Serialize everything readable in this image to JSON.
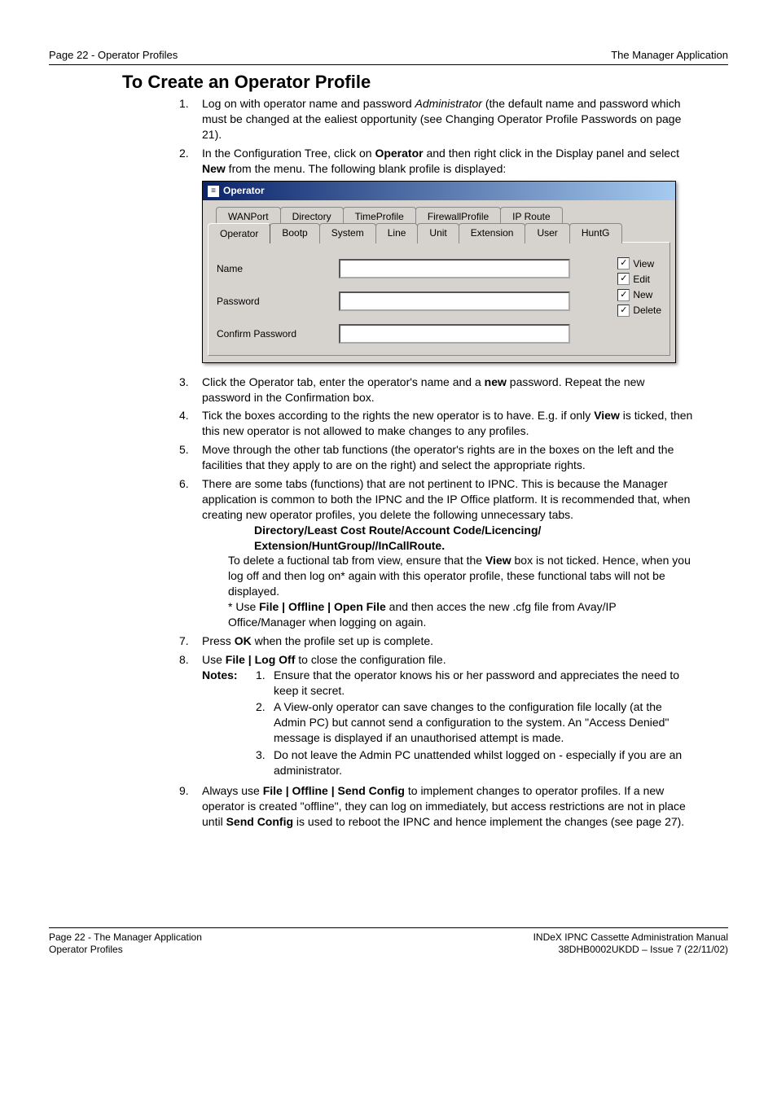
{
  "header": {
    "left": "Page 22 - Operator Profiles",
    "right": "The Manager Application"
  },
  "heading": "To Create an Operator Profile",
  "steps": {
    "s1": {
      "num": "1.",
      "p1a": "Log on with operator name and password ",
      "p1_admin": "Administrator",
      "p1b": " (the default name and password which must be changed at the ealiest opportunity (see Changing Operator Profile Passwords on page 21)."
    },
    "s2": {
      "num": "2.",
      "p1a": "In the Configuration Tree, click on ",
      "p1_op": "Operator",
      "p1b": " and then right click in the Display panel and select ",
      "p1_new": "New",
      "p1c": " from the menu. The following blank profile is displayed:"
    },
    "s3": {
      "num": "3.",
      "p1a": "Click the Operator tab, enter the operator's name and a ",
      "p1_new": "new",
      "p1b": " password. Repeat the new password in the Confirmation box."
    },
    "s4": {
      "num": "4.",
      "p1a": "Tick the boxes according to the rights the new operator is to have. E.g. if only ",
      "p1_view": "View",
      "p1b": " is ticked, then this new operator is not allowed to make changes to any profiles."
    },
    "s5": {
      "num": "5.",
      "p1": "Move through the other tab functions (the operator's rights are in the boxes on the left and the facilities that they apply to are on the right) and select the appropriate rights."
    },
    "s6": {
      "num": "6.",
      "p1": "There are some tabs (functions) that are not pertinent to IPNC. This is because the Manager application is common to both the IPNC and the IP Office platform. It is recommended that, when creating new operator profiles, you delete the following unnecessary tabs.",
      "bold_line1": "Directory/Least Cost Route/Account Code/Licencing/",
      "bold_line2": "Extension/HuntGroup//InCallRoute.",
      "p2a": "To delete a fuctional tab from view, ensure that the ",
      "p2_view": "View",
      "p2b": " box is not ticked. Hence, when you log off and then log on* again with this operator profile, these functional tabs will not be displayed.",
      "p3a": "* Use ",
      "p3_cmd": "File | Offline | Open File",
      "p3b": " and then acces the new .cfg file from Avay/IP Office/Manager when logging on again."
    },
    "s7": {
      "num": "7.",
      "p1a": "Press ",
      "p1_ok": "OK",
      "p1b": " when the profile set up is complete."
    },
    "s8": {
      "num": "8.",
      "p1a": "Use ",
      "p1_cmd": "File | Log Off",
      "p1b": " to close the configuration file.",
      "notes_label": "Notes:",
      "n1": {
        "num": "1.",
        "text": "Ensure that the operator knows his or her password and appreciates the need to keep it secret."
      },
      "n2": {
        "num": "2.",
        "text": "A View-only operator can save changes to the configuration file locally (at the Admin PC) but cannot send a configuration to the system. An \"Access Denied\" message is displayed if an unauthorised attempt is made."
      },
      "n3": {
        "num": "3.",
        "text": "Do not leave the Admin PC unattended whilst logged on - especially if you are an administrator."
      }
    },
    "s9": {
      "num": "9.",
      "p1a": "Always use ",
      "p1_cmd": "File | Offline | Send Config",
      "p1b": " to implement changes to operator profiles. If a new operator is created \"offline\", they can log on immediately, but access restrictions are not in place until ",
      "p1_cmd2": "Send Config",
      "p1c": " is used to reboot the IPNC and hence implement the changes (see page 27)."
    }
  },
  "dialog": {
    "title": "Operator",
    "tabs_back": [
      "WANPort",
      "Directory",
      "TimeProfile",
      "FirewallProfile",
      "IP Route"
    ],
    "tabs_front": [
      "Operator",
      "Bootp",
      "System",
      "Line",
      "Unit",
      "Extension",
      "User",
      "HuntG"
    ],
    "labels": {
      "name": "Name",
      "password": "Password",
      "confirm": "Confirm Password"
    },
    "checks": {
      "view": "View",
      "edit": "Edit",
      "new": "New",
      "delete": "Delete"
    },
    "checkmark": "✓"
  },
  "footer": {
    "left1": "Page 22 - The Manager Application",
    "left2": "Operator Profiles",
    "right1": "INDeX IPNC Cassette Administration Manual",
    "right2": "38DHB0002UKDD – Issue 7 (22/11/02)"
  }
}
